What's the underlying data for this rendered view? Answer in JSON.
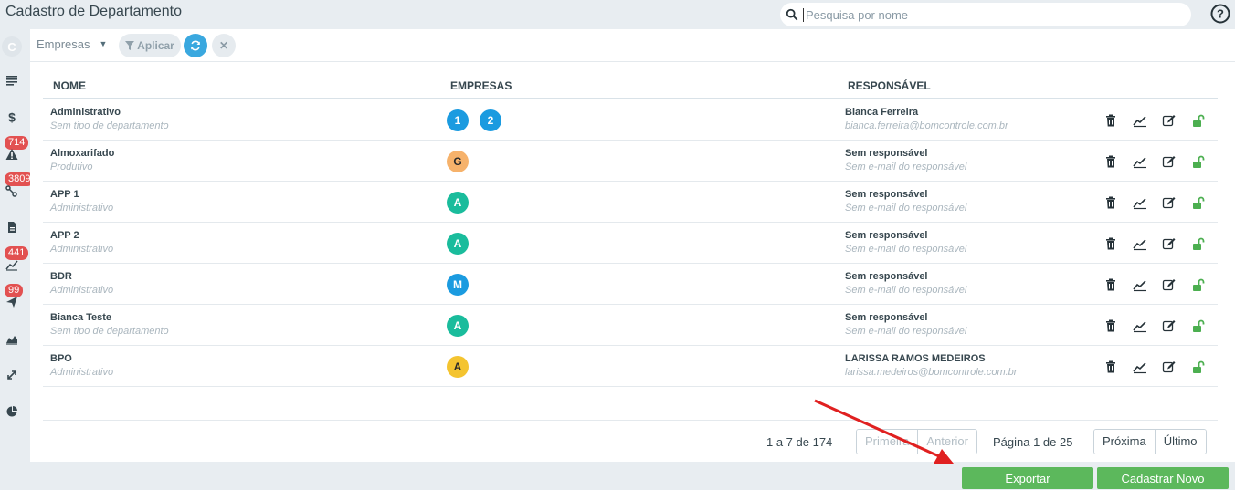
{
  "header": {
    "title": "Cadastro de Departamento",
    "search_placeholder": "Pesquisa por nome"
  },
  "sidebar": {
    "logo_letter": "C",
    "badges": [
      "714",
      "3809",
      "441",
      "99"
    ]
  },
  "filters": {
    "empresas_label": "Empresas",
    "apply_label": "Aplicar"
  },
  "table": {
    "columns": [
      "NOME",
      "EMPRESAS",
      "RESPONSÁVEL"
    ],
    "rows": [
      {
        "name": "Administrativo",
        "type": "Sem tipo de departamento",
        "companies": [
          {
            "label": "1",
            "color": "#1b9be0"
          },
          {
            "label": "2",
            "color": "#1b9be0"
          }
        ],
        "resp_name": "Bianca Ferreira",
        "resp_email": "bianca.ferreira@bomcontrole.com.br"
      },
      {
        "name": "Almoxarifado",
        "type": "Produtivo",
        "companies": [
          {
            "label": "G",
            "color": "#f6b26b"
          }
        ],
        "resp_name": "Sem responsável",
        "resp_email": "Sem e-mail do responsável"
      },
      {
        "name": "APP 1",
        "type": "Administrativo",
        "companies": [
          {
            "label": "A",
            "color": "#1abc9c"
          }
        ],
        "resp_name": "Sem responsável",
        "resp_email": "Sem e-mail do responsável"
      },
      {
        "name": "APP 2",
        "type": "Administrativo",
        "companies": [
          {
            "label": "A",
            "color": "#1abc9c"
          }
        ],
        "resp_name": "Sem responsável",
        "resp_email": "Sem e-mail do responsável"
      },
      {
        "name": "BDR",
        "type": "Administrativo",
        "companies": [
          {
            "label": "M",
            "color": "#1b9be0"
          }
        ],
        "resp_name": "Sem responsável",
        "resp_email": "Sem e-mail do responsável"
      },
      {
        "name": "Bianca Teste",
        "type": "Sem tipo de departamento",
        "companies": [
          {
            "label": "A",
            "color": "#1abc9c"
          }
        ],
        "resp_name": "Sem responsável",
        "resp_email": "Sem e-mail do responsável"
      },
      {
        "name": "BPO",
        "type": "Administrativo",
        "companies": [
          {
            "label": "A",
            "color": "#f4c430"
          }
        ],
        "resp_name": "LARISSA RAMOS MEDEIROS",
        "resp_email": "larissa.medeiros@bomcontrole.com.br"
      }
    ]
  },
  "pagination": {
    "range_text": "1 a 7 de 174",
    "first_label": "Primeira",
    "prev_label": "Anterior",
    "page_info": "Página 1 de 25",
    "next_label": "Próxima",
    "last_label": "Último"
  },
  "footer": {
    "export_label": "Exportar",
    "new_label": "Cadastrar Novo"
  },
  "colors": {
    "accent_blue": "#3aa8df",
    "green": "#5cb85c",
    "badge_red": "#e25151",
    "arrow_red": "#e02020"
  }
}
